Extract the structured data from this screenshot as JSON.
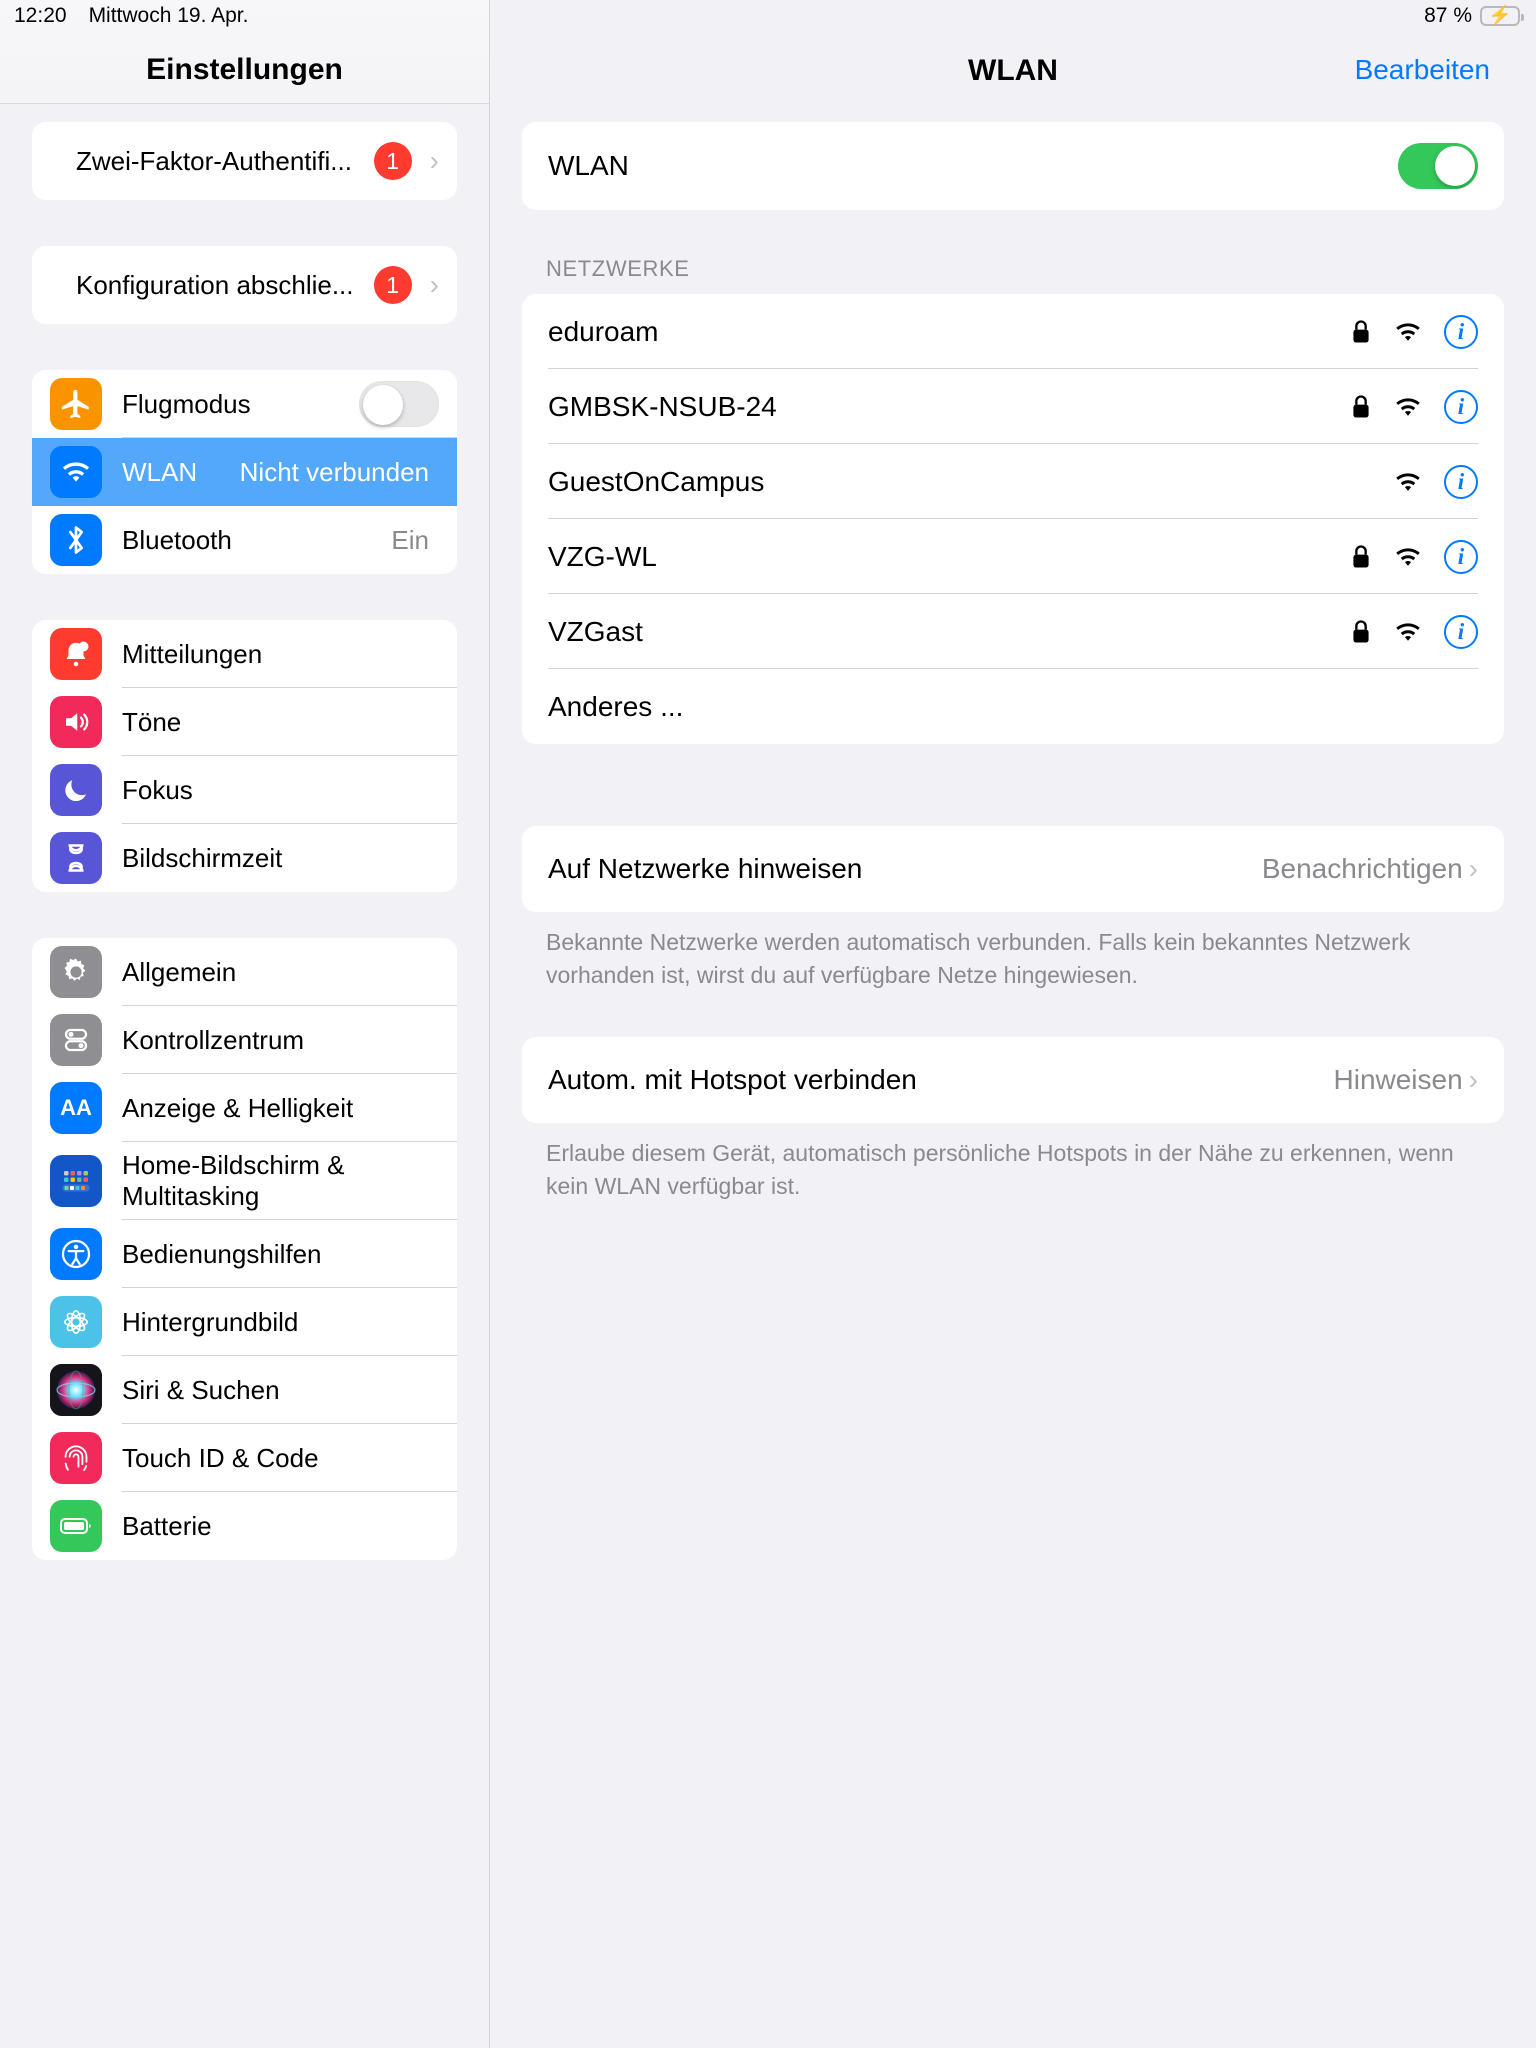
{
  "statusbar": {
    "time": "12:20",
    "date": "Mittwoch 19. Apr.",
    "battery_percent": "87 %"
  },
  "sidebar": {
    "title": "Einstellungen",
    "groups": [
      {
        "items": [
          {
            "label": "Zwei-Faktor-Authentifi...",
            "badge": "1",
            "chevron": "›"
          }
        ]
      },
      {
        "items": [
          {
            "label": "Konfiguration abschlie...",
            "badge": "1",
            "chevron": "›"
          }
        ]
      },
      {
        "items": [
          {
            "label": "Flugmodus",
            "icon": "airplane-icon",
            "toggle": "off"
          },
          {
            "label": "WLAN",
            "icon": "wifi-icon",
            "value": "Nicht verbunden",
            "selected": true
          },
          {
            "label": "Bluetooth",
            "icon": "bluetooth-icon",
            "value": "Ein"
          }
        ]
      },
      {
        "items": [
          {
            "label": "Mitteilungen",
            "icon": "bell-icon"
          },
          {
            "label": "Töne",
            "icon": "speaker-icon"
          },
          {
            "label": "Fokus",
            "icon": "moon-icon"
          },
          {
            "label": "Bildschirmzeit",
            "icon": "hourglass-icon"
          }
        ]
      },
      {
        "items": [
          {
            "label": "Allgemein",
            "icon": "gear-icon"
          },
          {
            "label": "Kontrollzentrum",
            "icon": "control-center-icon"
          },
          {
            "label": "Anzeige & Helligkeit",
            "icon": "display-aa-icon"
          },
          {
            "label": "Home-Bildschirm & Multitasking",
            "icon": "home-screen-icon"
          },
          {
            "label": "Bedienungshilfen",
            "icon": "accessibility-icon"
          },
          {
            "label": "Hintergrundbild",
            "icon": "wallpaper-icon"
          },
          {
            "label": "Siri & Suchen",
            "icon": "siri-icon"
          },
          {
            "label": "Touch ID & Code",
            "icon": "fingerprint-icon"
          },
          {
            "label": "Batterie",
            "icon": "battery-icon"
          }
        ]
      }
    ]
  },
  "detail": {
    "title": "WLAN",
    "edit_label": "Bearbeiten",
    "wifi_toggle": {
      "label": "WLAN",
      "state": "on"
    },
    "networks_header": "NETZWERKE",
    "networks": [
      {
        "ssid": "eduroam",
        "secured": true
      },
      {
        "ssid": "GMBSK-NSUB-24",
        "secured": true
      },
      {
        "ssid": "GuestOnCampus",
        "secured": false
      },
      {
        "ssid": "VZG-WL",
        "secured": true
      },
      {
        "ssid": "VZGast",
        "secured": true
      }
    ],
    "other_network_label": "Anderes ...",
    "ask_networks": {
      "label": "Auf Netzwerke hinweisen",
      "value": "Benachrichtigen",
      "chevron": "›",
      "footnote": "Bekannte Netzwerke werden automatisch verbunden. Falls kein bekanntes Netzwerk vorhanden ist, wirst du auf verfügbare Netze hingewiesen."
    },
    "auto_hotspot": {
      "label": "Autom. mit Hotspot verbinden",
      "value": "Hinweisen",
      "chevron": "›",
      "footnote": "Erlaube diesem Gerät, automatisch persönliche Hotspots in der Nähe zu erkennen, wenn kein WLAN verfügbar ist."
    }
  },
  "colors": {
    "accent_blue": "#007aff",
    "selected_blue": "#54a8fb",
    "green": "#34c759",
    "badge_red": "#ff3b30"
  }
}
